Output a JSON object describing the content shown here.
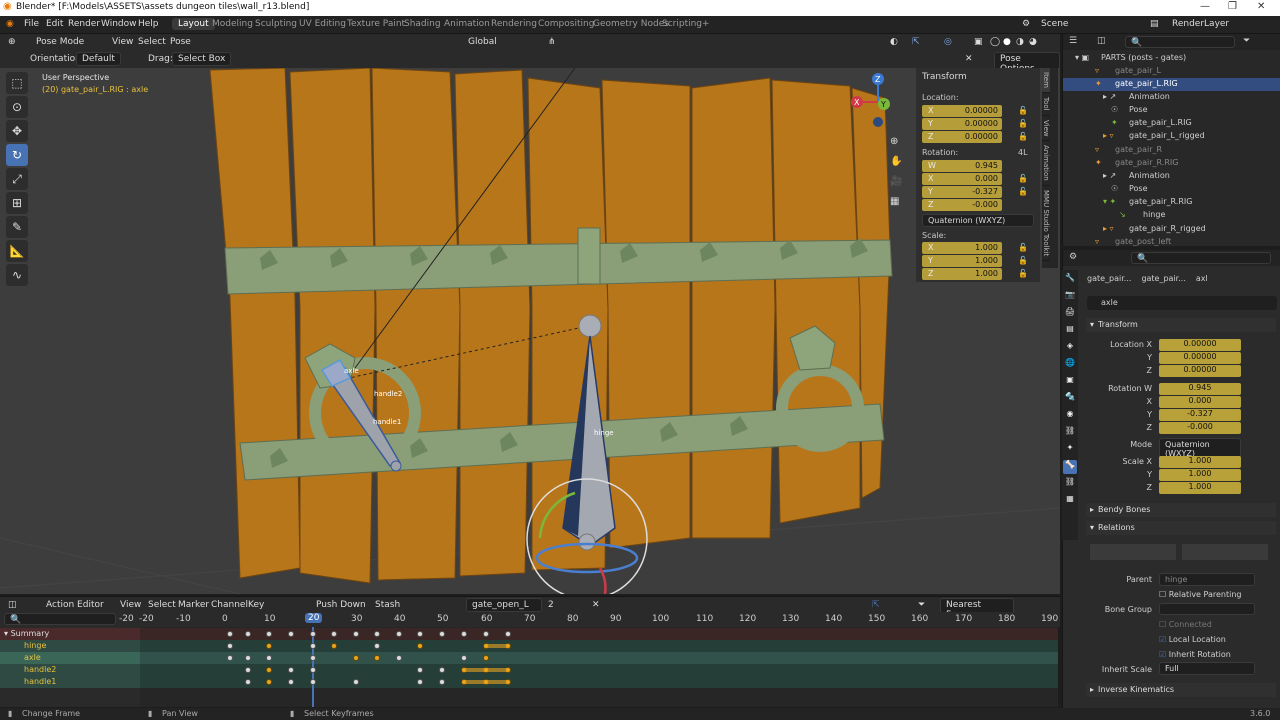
{
  "titlebar": {
    "title": "Blender* [F:\\Models\\ASSETS\\assets dungeon tiles\\wall_r13.blend]"
  },
  "menus": [
    "File",
    "Edit",
    "Render",
    "Window",
    "Help"
  ],
  "workspaces": [
    "Layout",
    "Modeling",
    "Sculpting",
    "UV Editing",
    "Texture Paint",
    "Shading",
    "Animation",
    "Rendering",
    "Compositing",
    "Geometry Nodes",
    "Scripting"
  ],
  "scene": {
    "name": "Scene",
    "render_layer": "RenderLayer"
  },
  "viewport_header": {
    "mode": "Pose Mode",
    "view": "View",
    "select": "Select",
    "pose": "Pose",
    "transform": "Global"
  },
  "viewport_sub": {
    "orientation_label": "Orientation:",
    "orientation": "Default",
    "drag_label": "Drag:",
    "drag": "Select Box",
    "pose_options": "Pose Options"
  },
  "viewport_info": {
    "line1": "User Perspective",
    "line2": "(20) gate_pair_L.RIG : axle"
  },
  "bones": {
    "axle": "axle",
    "handle2": "handle2",
    "handle1": "handle1",
    "hinge": "hinge"
  },
  "npanel": {
    "title": "Transform",
    "location_label": "Location:",
    "location": [
      {
        "axis": "X",
        "value": "0.00000"
      },
      {
        "axis": "Y",
        "value": "0.00000"
      },
      {
        "axis": "Z",
        "value": "0.00000"
      }
    ],
    "rotation_label": "Rotation:",
    "rotation_mode_short": "4L",
    "rotation": [
      {
        "axis": "W",
        "value": "0.945"
      },
      {
        "axis": "X",
        "value": "0.000"
      },
      {
        "axis": "Y",
        "value": "-0.327"
      },
      {
        "axis": "Z",
        "value": "-0.000"
      }
    ],
    "rotation_mode": "Quaternion (WXYZ)",
    "scale_label": "Scale:",
    "scale": [
      {
        "axis": "X",
        "value": "1.000"
      },
      {
        "axis": "Y",
        "value": "1.000"
      },
      {
        "axis": "Z",
        "value": "1.000"
      }
    ],
    "tabs": [
      "Item",
      "Tool",
      "View",
      "Animation",
      "MMU Studio Toolkit"
    ]
  },
  "outliner": {
    "rows": [
      "PARTS (posts - gates)",
      "gate_pair_L",
      "gate_pair_L.RIG",
      "Animation",
      "Pose",
      "gate_pair_L.RIG",
      "gate_pair_L_rigged",
      "gate_pair_R",
      "gate_pair_R.RIG",
      "Animation",
      "Pose",
      "gate_pair_R.RIG",
      "hinge",
      "gate_pair_R_rigged",
      "gate_post_left"
    ]
  },
  "props": {
    "breadcrumb": [
      "gate_pair...",
      "gate_pair...",
      "axl"
    ],
    "bone_name": "axle",
    "transform_title": "Transform",
    "location_labels": [
      "Location X",
      "Y",
      "Z"
    ],
    "location": [
      "0.00000",
      "0.00000",
      "0.00000"
    ],
    "rotation_labels": [
      "Rotation W",
      "X",
      "Y",
      "Z"
    ],
    "rotation": [
      "0.945",
      "0.000",
      "-0.327",
      "-0.000"
    ],
    "mode_label": "Mode",
    "mode": "Quaternion (WXYZ)",
    "scale_labels": [
      "Scale X",
      "Y",
      "Z"
    ],
    "scale": [
      "1.000",
      "1.000",
      "1.000"
    ],
    "bendy": "Bendy Bones",
    "relations": "Relations",
    "parent_label": "Parent",
    "parent": "hinge",
    "relative_parenting": "Relative Parenting",
    "bone_group_label": "Bone Group",
    "connected": "Connected",
    "local_location": "Local Location",
    "inherit_rotation": "Inherit Rotation",
    "inherit_scale_label": "Inherit Scale",
    "inherit_scale": "Full",
    "ik": "Inverse Kinematics"
  },
  "action_editor": {
    "mode": "Action Editor",
    "menus": [
      "View",
      "Select",
      "Marker",
      "Channel",
      "Key"
    ],
    "push_down": "Push Down",
    "stash": "Stash",
    "action": "gate_open_L",
    "users": "2",
    "snap": "Nearest Frame",
    "frames": [
      "-20",
      "-10",
      "0",
      "10",
      "20",
      "30",
      "40",
      "50",
      "60",
      "70",
      "80",
      "90",
      "100",
      "110",
      "120",
      "130",
      "140",
      "150",
      "160",
      "170",
      "180",
      "190"
    ],
    "current_frame": "20",
    "channels": [
      "Summary",
      "hinge",
      "axle",
      "handle2",
      "handle1"
    ]
  },
  "statusbar": {
    "change_frame": "Change Frame",
    "pan_view": "Pan View",
    "select_keyframes": "Select Keyframes",
    "version": "3.6.0"
  },
  "colors": {
    "accent": "#4772b3",
    "field": "#b9a13a",
    "selected_row": "#334d80"
  }
}
